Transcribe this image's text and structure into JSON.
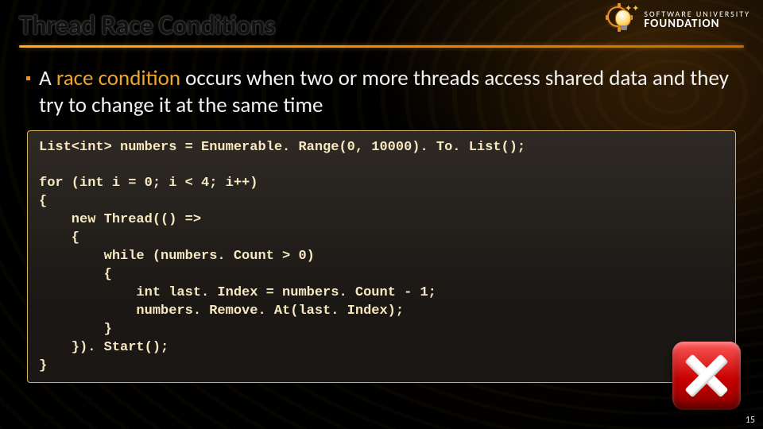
{
  "slide": {
    "title": "Thread Race Conditions",
    "bullet_prefix": "A ",
    "bullet_accent": "race condition",
    "bullet_rest": " occurs when two or more threads access shared data and they try to change it at the same time",
    "page_number": "15"
  },
  "logo": {
    "line1": "SOFTWARE UNIVERSITY",
    "line2": "FOUNDATION",
    "icon_name": "lightbulb-gear"
  },
  "code": {
    "text": "List<int> numbers = Enumerable. Range(0, 10000). To. List();\n\nfor (int i = 0; i < 4; i++)\n{\n    new Thread(() =>\n    {\n        while (numbers. Count > 0)\n        {\n            int last. Index = numbers. Count - 1;\n            numbers. Remove. At(last. Index);\n        }\n    }). Start();\n}"
  },
  "status_icon": {
    "name": "error-cross",
    "meaning": "incorrect / bug"
  }
}
